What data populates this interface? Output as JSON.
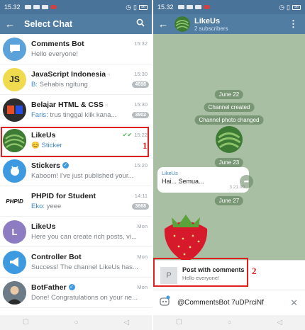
{
  "status": {
    "time": "15.32",
    "battery": "56"
  },
  "left": {
    "title": "Select Chat",
    "chats": [
      {
        "name": "Comments Bot",
        "time": "15:32",
        "preview": "Hello everyone!",
        "sender": "",
        "badge": "",
        "avatar_color": "#5aa2d9",
        "avatar": "chat-bubble"
      },
      {
        "name": "JavaScript Indonesia",
        "time": "15:30",
        "preview": "Sehabis ngitung",
        "sender": "B:",
        "badge": "4698",
        "avatar_color": "#f0db4f",
        "avatar": "JS"
      },
      {
        "name": "Belajar HTML & CSS",
        "time": "15:30",
        "preview": "trus tinggal klik kana...",
        "sender": "Faris:",
        "badge": "3902",
        "avatar_color": "#2d2d2d",
        "avatar": "HTML&CSS"
      },
      {
        "name": "LikeUs",
        "time": "15:22",
        "preview": "Sticker",
        "sender": "",
        "badge": "",
        "avatar_color": "#3f7a3a",
        "avatar": "melon"
      },
      {
        "name": "Stickers",
        "time": "15:20",
        "preview": "Kaboom! I've just published your...",
        "sender": "",
        "badge": "",
        "avatar_color": "#3e9ae0",
        "avatar": "sticker"
      },
      {
        "name": "PHPID for Student",
        "time": "14:11",
        "preview": "yeee",
        "sender": "Eko:",
        "badge": "3668",
        "avatar_color": "#ffffff",
        "avatar": "PHPID"
      },
      {
        "name": "LikeUs",
        "time": "Mon",
        "preview": "Here you can create rich posts, vi...",
        "sender": "",
        "badge": "",
        "avatar_color": "#8e7cc3",
        "avatar": "L"
      },
      {
        "name": "Controller Bot",
        "time": "Mon",
        "preview": "Success! The channel LikeUs has...",
        "sender": "",
        "badge": "",
        "avatar_color": "#3e9ae0",
        "avatar": "megaphone"
      },
      {
        "name": "BotFather",
        "time": "Mon",
        "preview": "Done! Congratulations on your ne...",
        "sender": "",
        "badge": "",
        "avatar_color": "#5a6b7a",
        "avatar": "botfather"
      }
    ],
    "marker": "1"
  },
  "right": {
    "channel_name": "LikeUs",
    "subscribers": "2 subscribers",
    "date1": "June 22",
    "event1": "Channel created",
    "event2": "Channel photo changed",
    "date2": "June 23",
    "bubble_name": "LikeUs",
    "bubble_text": "Hai... Semua...",
    "bubble_meta": "3  21.00",
    "date3": "June 27",
    "inline_thumb": "P",
    "inline_title": "Post with comments",
    "inline_sub": "Hello everyone!",
    "input_text": "@CommentsBot 7uDPrciNf",
    "marker": "2"
  },
  "colors": {
    "header": "#517da2",
    "accent": "#3e87c5",
    "highlight": "#e02020"
  }
}
